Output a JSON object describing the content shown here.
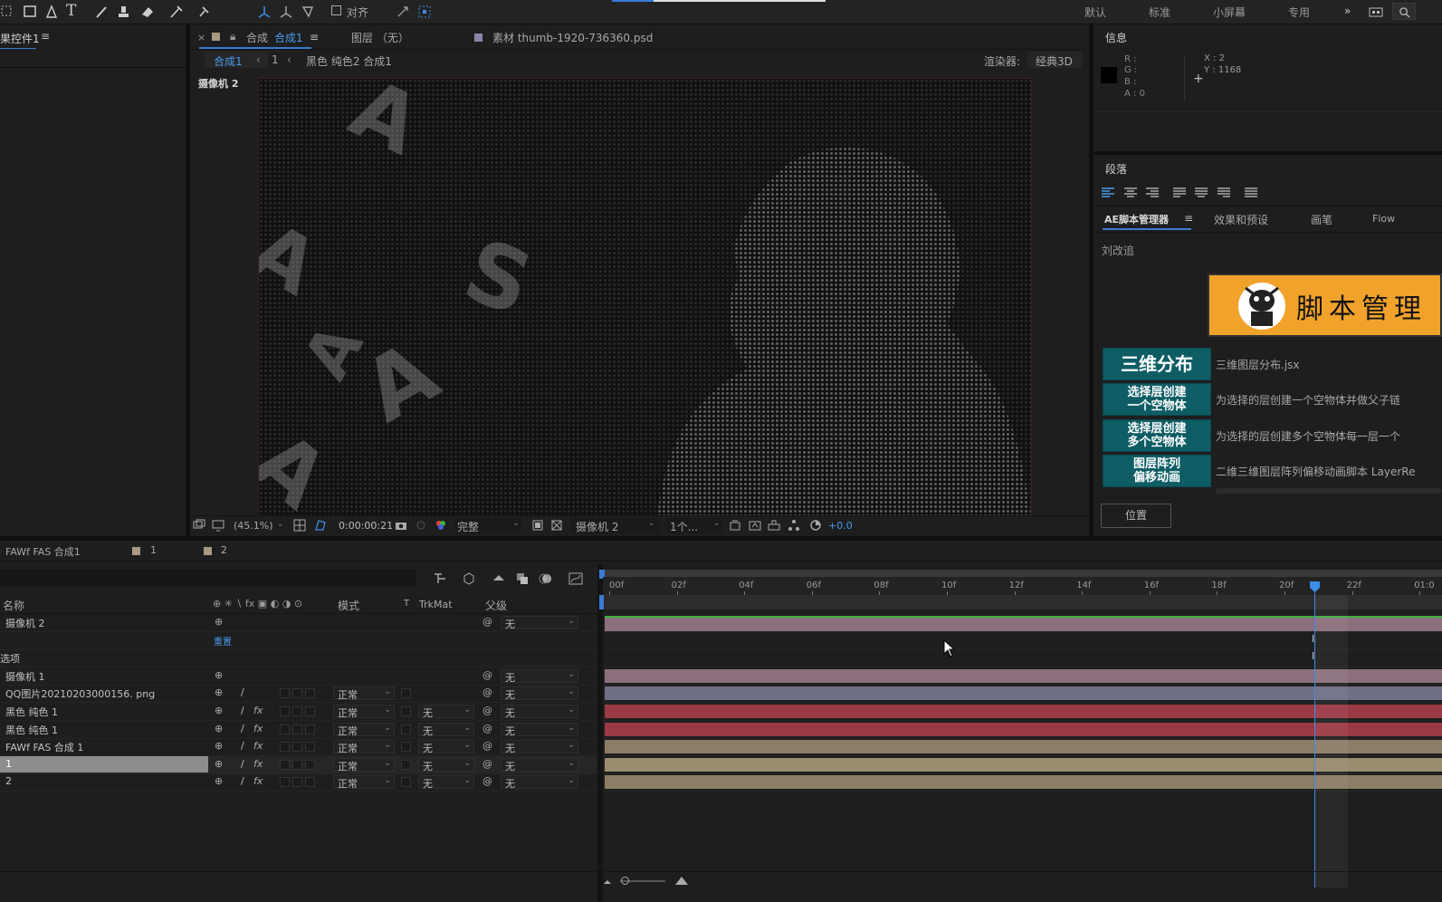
{
  "toolbar": {
    "snap_label": "对齐",
    "workspaces": [
      "默认",
      "标准",
      "小屏幕",
      "专用"
    ]
  },
  "left_panel": {
    "tab": "果控件1"
  },
  "viewer": {
    "tab_comp_prefix": "合成",
    "tab_comp_name": "合成1",
    "tab_layer": "图层 （无）",
    "tab_footage": "素材 thumb-1920-736360.psd",
    "breadcrumb_active": "合成1",
    "breadcrumb_num": "1",
    "breadcrumb_path": "黑色 纯色2 合成1",
    "renderer_label": "渲染器:",
    "renderer_value": "经典3D",
    "camera_label": "摄像机 2",
    "canvas_letters": [
      "A",
      "A",
      "S",
      "A",
      "A",
      "A"
    ],
    "footer": {
      "zoom": "(45.1%)",
      "timecode": "0:00:00:21",
      "resolution": "完整",
      "camera": "摄像机 2",
      "views": "1个...",
      "exposure": "+0.0"
    }
  },
  "info_panel": {
    "title": "信息",
    "r": "R :",
    "g": "G :",
    "b": "B :",
    "a": "A : 0",
    "x": "X : 2",
    "y": "Y : 1168"
  },
  "paragraph_panel": {
    "title": "段落"
  },
  "script_panel": {
    "tabs": [
      "AE脚本管理器",
      "效果和预设",
      "画笔",
      "Flow"
    ],
    "author": "刘改追",
    "banner_text": "脚本管理",
    "commands": [
      {
        "label": "三维分布",
        "desc": "三维图层分布.jsx"
      },
      {
        "label": "选择层创建\n一个空物体",
        "desc": "为选择的层创建一个空物体并做父子链"
      },
      {
        "label": "选择层创建\n多个空物体",
        "desc": "为选择的层创建多个空物体每一层一个"
      },
      {
        "label": "图层阵列\n偏移动画",
        "desc": "二维三维图层阵列偏移动画脚本 LayerRe"
      }
    ],
    "position_button": "位置"
  },
  "timeline": {
    "tabs": [
      "FAWf FAS 合成1",
      "1",
      "2"
    ],
    "headers": {
      "name": "名称",
      "mode": "模式",
      "t": "T",
      "trkmat": "TrkMat",
      "parent": "父级"
    },
    "ruler": [
      "00f",
      "02f",
      "04f",
      "06f",
      "08f",
      "10f",
      "12f",
      "14f",
      "16f",
      "18f",
      "20f",
      "22f",
      "01:0"
    ],
    "layers": [
      {
        "name": "摄像机 2",
        "mode": "",
        "trk": "",
        "parent": "无",
        "color": "#8b6f7c"
      },
      {
        "name": "",
        "sub": "重置",
        "mode": "",
        "trk": "",
        "parent": "",
        "color": ""
      },
      {
        "name": "选项",
        "mode": "",
        "trk": "",
        "parent": "",
        "color": ""
      },
      {
        "name": "摄像机 1",
        "mode": "",
        "trk": "",
        "parent": "无",
        "color": "#8b6f7c"
      },
      {
        "name": "QQ图片20210203000156. png",
        "mode": "正常",
        "trk": "",
        "parent": "无",
        "color": "#6f6f86"
      },
      {
        "name": "黑色 纯色 1",
        "mode": "正常",
        "trk": "无",
        "parent": "无",
        "color": "#9a3a45"
      },
      {
        "name": "黑色 纯色 1",
        "mode": "正常",
        "trk": "无",
        "parent": "无",
        "color": "#9a3a45"
      },
      {
        "name": "FAWf FAS 合成 1",
        "mode": "正常",
        "trk": "无",
        "parent": "无",
        "color": "#8c7d66"
      },
      {
        "name": "1",
        "mode": "正常",
        "trk": "无",
        "parent": "无",
        "color": "#9a8a6e"
      },
      {
        "name": "2",
        "mode": "正常",
        "trk": "无",
        "parent": "无",
        "color": "#8c7d66"
      }
    ]
  }
}
